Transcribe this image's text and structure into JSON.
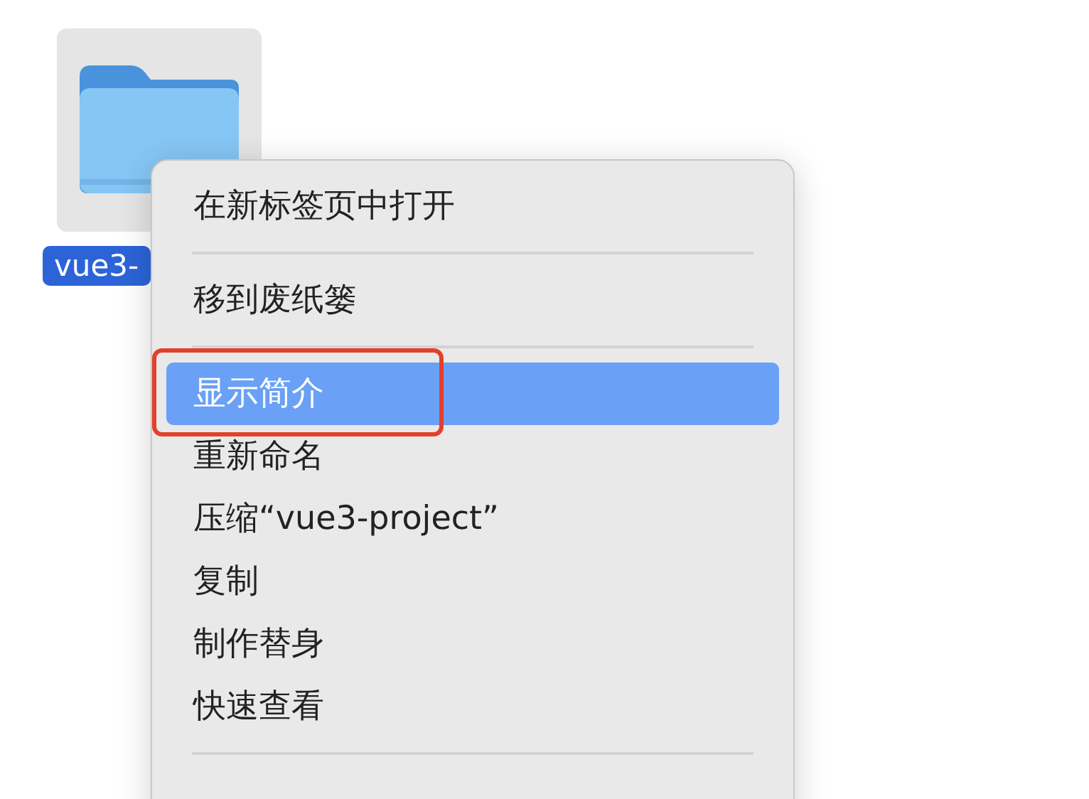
{
  "file": {
    "label": "vue3-",
    "selected": true
  },
  "context_menu": {
    "items": [
      {
        "kind": "item",
        "label": "在新标签页中打开",
        "selected": false,
        "annotated": false
      },
      {
        "kind": "separator"
      },
      {
        "kind": "item",
        "label": "移到废纸篓",
        "selected": false,
        "annotated": false
      },
      {
        "kind": "separator"
      },
      {
        "kind": "item",
        "label": "显示简介",
        "selected": true,
        "annotated": true
      },
      {
        "kind": "item",
        "label": "重新命名",
        "selected": false,
        "annotated": false
      },
      {
        "kind": "item",
        "label": "压缩“vue3-project”",
        "selected": false,
        "annotated": false
      },
      {
        "kind": "item",
        "label": "复制",
        "selected": false,
        "annotated": false
      },
      {
        "kind": "item",
        "label": "制作替身",
        "selected": false,
        "annotated": false
      },
      {
        "kind": "item",
        "label": "快速查看",
        "selected": false,
        "annotated": false
      },
      {
        "kind": "separator"
      }
    ]
  }
}
